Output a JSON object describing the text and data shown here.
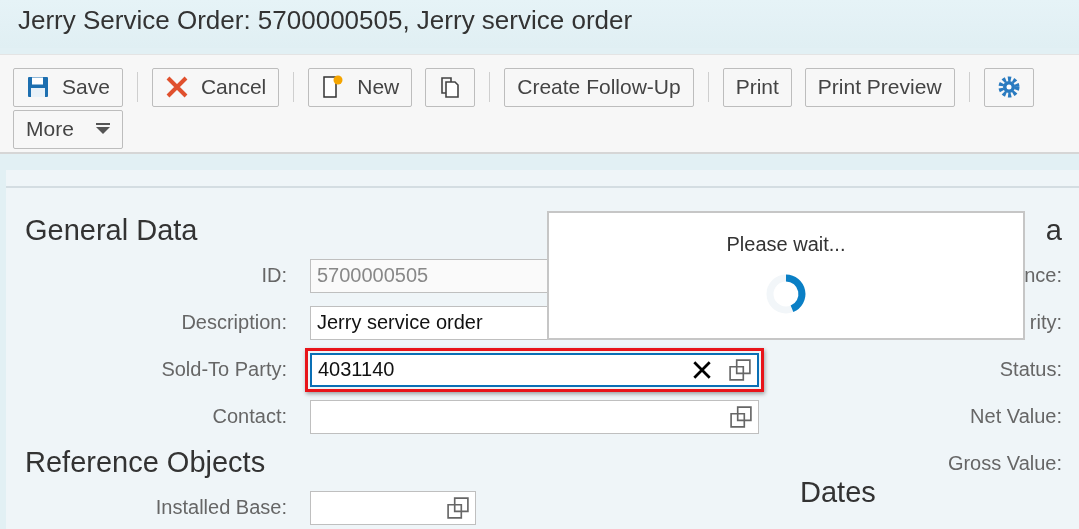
{
  "window": {
    "title": "Jerry Service Order: 5700000505, Jerry service order"
  },
  "toolbar": {
    "rows": [
      [
        {
          "kind": "save",
          "label": "Save"
        },
        {
          "kind": "separator"
        },
        {
          "kind": "cancel",
          "label": "Cancel"
        },
        {
          "kind": "separator"
        },
        {
          "kind": "new",
          "label": "New"
        },
        {
          "kind": "copy"
        },
        {
          "kind": "separator"
        },
        {
          "kind": "button",
          "label": "Create Follow-Up"
        },
        {
          "kind": "separator"
        },
        {
          "kind": "button",
          "label": "Print"
        },
        {
          "kind": "button",
          "label": "Print Preview"
        },
        {
          "kind": "separator"
        },
        {
          "kind": "settings"
        }
      ],
      [
        {
          "kind": "menu",
          "label": "More"
        }
      ]
    ]
  },
  "left": [
    {
      "kind": "heading",
      "text": "General Data"
    },
    {
      "kind": "field",
      "label": "ID:",
      "value": "5700000505",
      "readonly": true,
      "focused": false,
      "highlighted": false
    },
    {
      "kind": "field",
      "label": "Description:",
      "value": "Jerry service order",
      "readonly": false,
      "focused": false,
      "highlighted": false
    },
    {
      "kind": "field",
      "label": "Sold-To Party:",
      "value": "4031140",
      "readonly": false,
      "focused": true,
      "highlighted": true,
      "clearable": true,
      "value_help": true
    },
    {
      "kind": "field",
      "label": "Contact:",
      "readonly": false,
      "focused": false,
      "highlighted": false,
      "clearable": false,
      "value_help": true
    },
    {
      "kind": "heading",
      "text": "Reference Objects"
    },
    {
      "kind": "field",
      "label": "Installed Base:",
      "readonly": false,
      "focused": false,
      "highlighted": false,
      "clearable": false,
      "value_help": true,
      "short": true
    }
  ],
  "right": [
    {
      "kind": "heading",
      "text": "a"
    },
    {
      "kind": "label",
      "text": "nce:"
    },
    {
      "kind": "label",
      "text": "rity:"
    },
    {
      "kind": "label",
      "text": "Status:"
    },
    {
      "kind": "label",
      "text": "Net Value:"
    },
    {
      "kind": "label",
      "text": "Gross Value:"
    },
    {
      "kind": "subheading",
      "text": "Dates"
    }
  ],
  "busy_dialog": {
    "message": "Please wait..."
  }
}
